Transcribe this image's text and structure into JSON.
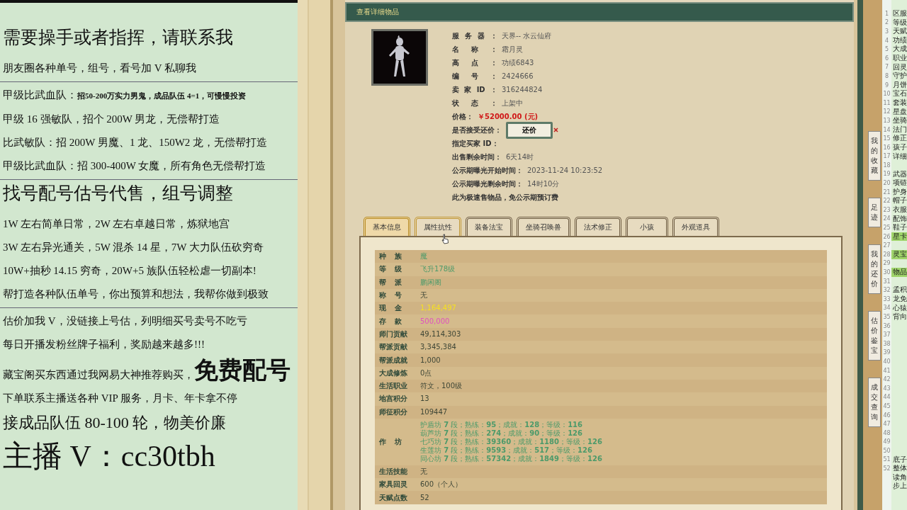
{
  "promo_panel": {
    "lines": [
      {
        "kind": "large",
        "text": "需要操手或者指挥，请联系我"
      },
      {
        "kind": "medium",
        "text": "朋友圈各种单号，组号，看号加 V 私聊我",
        "divider_after": true
      },
      {
        "kind": "split",
        "text": "甲级比武血队：",
        "detail": "招50-200万实力男鬼，成品队伍 4=1，可慢慢投资"
      },
      {
        "kind": "medium",
        "text": "甲级 16 强敏队，招个 200W 男龙，无偿帮打造"
      },
      {
        "kind": "medium",
        "text": "比武敏队：招 200W 男魔、1 龙、150W2 龙，无偿帮打造"
      },
      {
        "kind": "medium",
        "text": "甲级比武血队：招 300-400W 女魔，所有角色无偿帮打造",
        "divider_after": true
      },
      {
        "kind": "large",
        "text": "找号配号估号代售，组号调整"
      },
      {
        "kind": "medium",
        "text": "1W 左右简单日常，2W 左右卓越日常，炼狱地宫"
      },
      {
        "kind": "medium",
        "text": "3W 左右异光通关，5W 混杀 14 星，7W 大力队伍砍穷奇"
      },
      {
        "kind": "medium",
        "text": "10W+抽秒 14.15 穷奇，20W+5 族队伍轻松虐一切副本!"
      },
      {
        "kind": "medium",
        "text": "帮打造各种队伍单号，你出预算和想法，我帮你做到极致",
        "divider_after": true
      },
      {
        "kind": "medium",
        "text": "估价加我 V，没链接上号估，列明细买号卖号不吃亏"
      },
      {
        "kind": "medium",
        "text": "每日开播发粉丝牌子福利，奖励越来越多!!!"
      },
      {
        "kind": "emphasis",
        "text": "藏宝阁买东西通过我网易大神推荐购买，",
        "detail": "免费配号"
      },
      {
        "kind": "medium",
        "text": "下单联系主播送各种 VIP 服务，月卡、年卡拿不停"
      },
      {
        "kind": "big",
        "text": "接成品队伍 80-100 轮，物美价廉"
      },
      {
        "kind": "huge",
        "text": "主播 V：cc30tbh"
      }
    ]
  },
  "item_window": {
    "title": "查看详细物品",
    "info": [
      {
        "kind": "justified",
        "label": "服务器：",
        "value": "天界-- 水云仙府"
      },
      {
        "kind": "justified",
        "label": "名称：",
        "value": "霜月灵"
      },
      {
        "kind": "justified",
        "label": "高点：",
        "value": "功绩6843"
      },
      {
        "kind": "justified",
        "label": "编号：",
        "value": "2424666"
      },
      {
        "kind": "justified",
        "label": "卖家ID：",
        "value": "316244824"
      },
      {
        "kind": "justified",
        "label": "状态：",
        "value": "上架中"
      },
      {
        "kind": "price",
        "label": "价格：",
        "value": "￥52000.00 (元)"
      },
      {
        "kind": "button",
        "label": "是否接受还价：",
        "value": "还价"
      },
      {
        "kind": "plain",
        "label": "指定买家 ID："
      },
      {
        "kind": "plain",
        "label": "出售剩余时间：",
        "value": "6天14时"
      },
      {
        "kind": "plain",
        "label": "公示期曝光开始时间：",
        "value": "2023-11-24 10:23:52"
      },
      {
        "kind": "plain",
        "label": "公示期曝光剩余时间：",
        "value": "14时10分"
      },
      {
        "kind": "plain",
        "label": "此为极速售物品，免公示期预订费"
      }
    ],
    "tabs": [
      {
        "label": "基本信息",
        "selected": true,
        "hovered": false
      },
      {
        "label": "属性抗性",
        "selected": false,
        "hovered": true
      },
      {
        "label": "装备法宝",
        "selected": false,
        "hovered": false
      },
      {
        "label": "坐骑召唤兽",
        "selected": false,
        "hovered": false
      },
      {
        "label": "法术修正",
        "selected": false,
        "hovered": false
      },
      {
        "label": "小孩",
        "selected": false,
        "hovered": false
      },
      {
        "label": "外观道具",
        "selected": false,
        "hovered": false
      }
    ],
    "rows": [
      {
        "label": "种族",
        "kind": "green",
        "values": [
          "魔"
        ]
      },
      {
        "label": "等级",
        "kind": "green",
        "values": [
          "飞升178级"
        ]
      },
      {
        "label": "帮派",
        "kind": "green",
        "values": [
          "鹏闲阁"
        ]
      },
      {
        "label": "称号",
        "kind": "plain",
        "values": [
          "无"
        ]
      },
      {
        "label": "现金",
        "kind": "yellow",
        "values": [
          "1,164,497"
        ]
      },
      {
        "label": "存款",
        "kind": "pink",
        "values": [
          "500,000"
        ]
      },
      {
        "label": "师门贡献",
        "kind": "plain",
        "values": [
          "49,114,303"
        ]
      },
      {
        "label": "帮派贡献",
        "kind": "plain",
        "values": [
          "3,345,384"
        ]
      },
      {
        "label": "帮派成就",
        "kind": "plain",
        "values": [
          "1,000"
        ]
      },
      {
        "label": "大成修炼",
        "kind": "plain",
        "values": [
          "0点"
        ]
      },
      {
        "label": "生活职业",
        "kind": "plain",
        "values": [
          "符文，100级"
        ]
      },
      {
        "label": "地宫积分",
        "kind": "plain",
        "values": [
          "13"
        ]
      },
      {
        "label": "师征积分",
        "kind": "plain",
        "values": [
          "109447"
        ]
      },
      {
        "label": "作坊",
        "kind": "green",
        "values": [
          "护盾坊 **7** 段；熟练：**95**；成就：**128**；等级：**116**",
          "葫芦坊 **7** 段；熟练：**274**；成就：**90**；等级：**126**",
          "七巧坊 **7** 段；熟练：**39360**；成就：**1180**；等级：**126**",
          "生莲坊 **7** 段；熟练：**9593**；成就：**517**；等级：**126**",
          "同心坊 **7** 段；熟练：**57342**；成就：**1849**；等级：**126**"
        ]
      },
      {
        "label": "生活技能",
        "kind": "plain",
        "values": [
          "无"
        ]
      },
      {
        "label": "家具回灵",
        "kind": "plain",
        "values": [
          "600（个人）"
        ]
      },
      {
        "label": "天赋点数",
        "kind": "plain",
        "values": [
          "52"
        ]
      }
    ]
  },
  "side_buttons": [
    "我的收藏",
    "足迹",
    "我的还价",
    "估价鉴宝",
    "成交查询"
  ],
  "editor": {
    "lines": [
      {
        "number": "1",
        "text": "区服",
        "highlighted": false
      },
      {
        "number": "2",
        "text": "等级",
        "highlighted": false
      },
      {
        "number": "3",
        "text": "天赋",
        "highlighted": false
      },
      {
        "number": "4",
        "text": "功绩",
        "highlighted": false
      },
      {
        "number": "5",
        "text": "大成",
        "highlighted": false
      },
      {
        "number": "6",
        "text": "职业",
        "highlighted": false
      },
      {
        "number": "7",
        "text": "回灵",
        "highlighted": false
      },
      {
        "number": "8",
        "text": "守护",
        "highlighted": false
      },
      {
        "number": "9",
        "text": "月饼",
        "highlighted": false
      },
      {
        "number": "10",
        "text": "宝石",
        "highlighted": false
      },
      {
        "number": "11",
        "text": "套装",
        "highlighted": false
      },
      {
        "number": "12",
        "text": "星盘",
        "highlighted": false
      },
      {
        "number": "13",
        "text": "坐骑",
        "highlighted": false
      },
      {
        "number": "14",
        "text": "法门",
        "highlighted": false
      },
      {
        "number": "15",
        "text": "修正",
        "highlighted": false
      },
      {
        "number": "16",
        "text": "孩子",
        "highlighted": false
      },
      {
        "number": "17",
        "text": "详细",
        "highlighted": false
      },
      {
        "number": "18",
        "highlighted": false
      },
      {
        "number": "19",
        "text": "武器",
        "highlighted": false
      },
      {
        "number": "20",
        "text": "项链",
        "highlighted": false
      },
      {
        "number": "21",
        "text": "护身",
        "highlighted": false
      },
      {
        "number": "22",
        "text": "帽子",
        "highlighted": false
      },
      {
        "number": "23",
        "text": "衣服",
        "highlighted": false
      },
      {
        "number": "24",
        "text": "配饰",
        "highlighted": false
      },
      {
        "number": "25",
        "text": "鞋子",
        "highlighted": false
      },
      {
        "number": "26",
        "text": "星卡",
        "highlighted": true
      },
      {
        "number": "27",
        "highlighted": false
      },
      {
        "number": "28",
        "text": "灵宝",
        "highlighted": true
      },
      {
        "number": "29",
        "highlighted": false
      },
      {
        "number": "30",
        "text": "物品",
        "highlighted": true
      },
      {
        "number": "31",
        "highlighted": false
      },
      {
        "number": "32",
        "text": "孟积",
        "highlighted": false
      },
      {
        "number": "33",
        "text": "龙免",
        "highlighted": false
      },
      {
        "number": "34",
        "text": "心猿",
        "highlighted": false
      },
      {
        "number": "35",
        "text": "背向",
        "highlighted": false
      },
      {
        "number": "36",
        "highlighted": false
      },
      {
        "number": "37",
        "highlighted": false
      },
      {
        "number": "38",
        "highlighted": false
      },
      {
        "number": "39",
        "highlighted": false
      },
      {
        "number": "40",
        "highlighted": false
      },
      {
        "number": "41",
        "highlighted": false
      },
      {
        "number": "42",
        "highlighted": false
      },
      {
        "number": "43",
        "highlighted": false
      },
      {
        "number": "44",
        "highlighted": false
      },
      {
        "number": "45",
        "highlighted": false
      },
      {
        "number": "46",
        "highlighted": false
      },
      {
        "number": "47",
        "highlighted": false
      },
      {
        "number": "48",
        "highlighted": false
      },
      {
        "number": "49",
        "highlighted": false
      },
      {
        "number": "50",
        "highlighted": false
      },
      {
        "number": "51",
        "text": "底子",
        "highlighted": false
      },
      {
        "number": "52",
        "text": "整体",
        "highlighted": false
      },
      {
        "text": "读角",
        "highlighted": false
      },
      {
        "text": "步上",
        "highlighted": false
      }
    ]
  }
}
